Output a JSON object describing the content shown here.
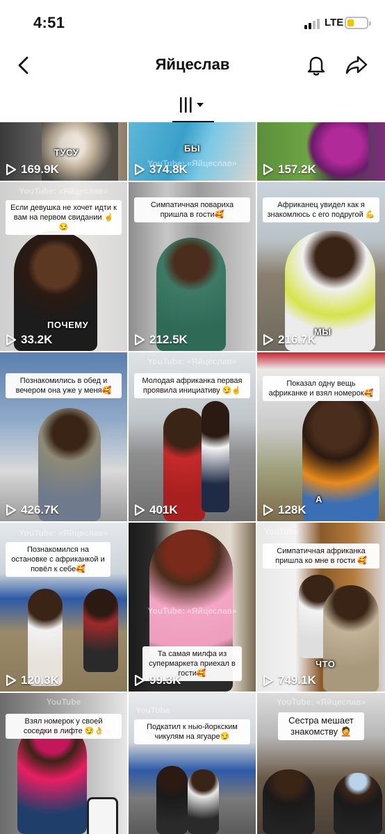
{
  "status_bar": {
    "time": "4:51",
    "network": "LTE",
    "battery_color": "#f2c200"
  },
  "header": {
    "title": "Яйцеслав",
    "back_icon": "chevron-left-icon",
    "bell_icon": "bell-icon",
    "share_icon": "share-arrow-icon"
  },
  "tabs": {
    "active_icon": "grid-filter-icon"
  },
  "grid": {
    "tiles": [
      {
        "views": "169.9K",
        "caption": "",
        "overlay": "ТУСУ",
        "watermark": ""
      },
      {
        "views": "374.8K",
        "caption": "",
        "overlay": "БЫ",
        "watermark": "YouTube: «Яйцеслав»"
      },
      {
        "views": "157.2K",
        "caption": "",
        "overlay": "",
        "watermark": ""
      },
      {
        "views": "33.2K",
        "caption": "Если девушка не хочет идти к вам на первом свидании ☝️😏",
        "overlay": "ПОЧЕМУ",
        "watermark": "YouTube: «Яйцеслав»"
      },
      {
        "views": "212.5K",
        "caption": "Симпатичная повариха пришла в гости🥰",
        "overlay": "",
        "watermark": ""
      },
      {
        "views": "216.7K",
        "caption": "Африканец увидел как я знакомлюсь с его подругой 💪",
        "overlay": "МЫ",
        "watermark": ""
      },
      {
        "views": "426.7K",
        "caption": "Познакомились в обед и вечером она уже у меня🥰",
        "overlay": "",
        "watermark": ""
      },
      {
        "views": "401K",
        "caption": "Молодая африканка первая проявила инициативу 😏☝️",
        "overlay": "",
        "watermark": "YouTube: «Яйцеслав»"
      },
      {
        "views": "128K",
        "caption": "Показал одну вещь африканке и взял номерок🥰",
        "overlay": "А",
        "watermark": ""
      },
      {
        "views": "120.3K",
        "caption": "Познакомился на остановке с африканкой и повёл к себе🥰",
        "overlay": "",
        "watermark": "YouTube: «Яйцеслав»"
      },
      {
        "views": "99.3K",
        "caption": "Та самая милфа из супермаркета приехал в гости🥰",
        "overlay": "",
        "watermark": "YouTube: «Яйцеслав»"
      },
      {
        "views": "749.1K",
        "caption": "Симпатичная африканка пришла ко мне в гости 🥰",
        "overlay": "ЧТО",
        "watermark": "YouTube"
      },
      {
        "views": "",
        "caption": "Взял номерок у своей соседки в лифте 😏👌",
        "overlay": "",
        "watermark": "YouTube"
      },
      {
        "views": "",
        "caption": "Подкатил к нью-йоркским чикулям на ягуаре😏",
        "overlay": "",
        "watermark": "YouTube"
      },
      {
        "views": "",
        "caption": "Сестра мешает знакомству 🤦",
        "overlay": "",
        "watermark": "YouTube: «Яйцеслав»"
      }
    ]
  }
}
